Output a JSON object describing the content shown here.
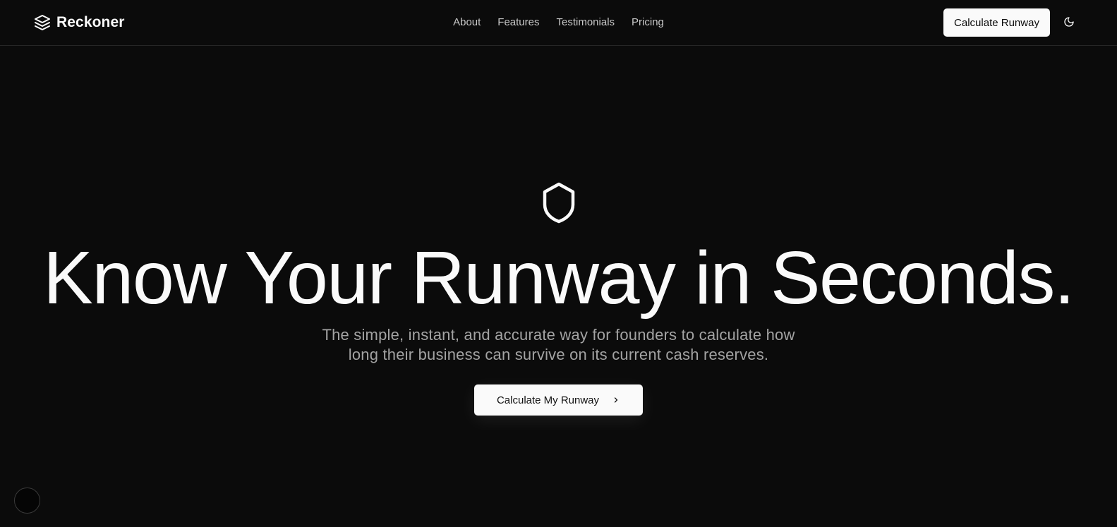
{
  "header": {
    "brand": {
      "name": "Reckoner",
      "icon": "layers-icon"
    },
    "nav": [
      {
        "label": "About"
      },
      {
        "label": "Features"
      },
      {
        "label": "Testimonials"
      },
      {
        "label": "Pricing"
      }
    ],
    "cta_label": "Calculate Runway",
    "theme_toggle_icon": "moon-icon"
  },
  "hero": {
    "icon": "shield-icon",
    "title": "Know Your Runway in Seconds.",
    "subtitle": "The simple, instant, and accurate way for founders to calculate how long their business can survive on its current cash reserves.",
    "cta_label": "Calculate My Runway",
    "cta_icon": "chevron-right-icon"
  },
  "colors": {
    "background": "#0b0b0b",
    "foreground": "#fafafa",
    "muted": "#a3a3a3",
    "button_bg": "#fafafa",
    "button_text": "#0b0b0b"
  }
}
